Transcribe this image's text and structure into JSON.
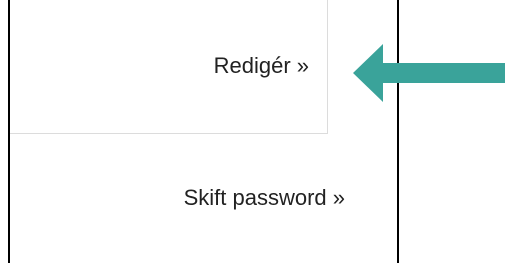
{
  "menu": {
    "edit_label": "Redigér »",
    "change_password_label": "Skift password »"
  },
  "callout": {
    "icon": "arrow-left-icon",
    "color": "#3aa39a"
  }
}
